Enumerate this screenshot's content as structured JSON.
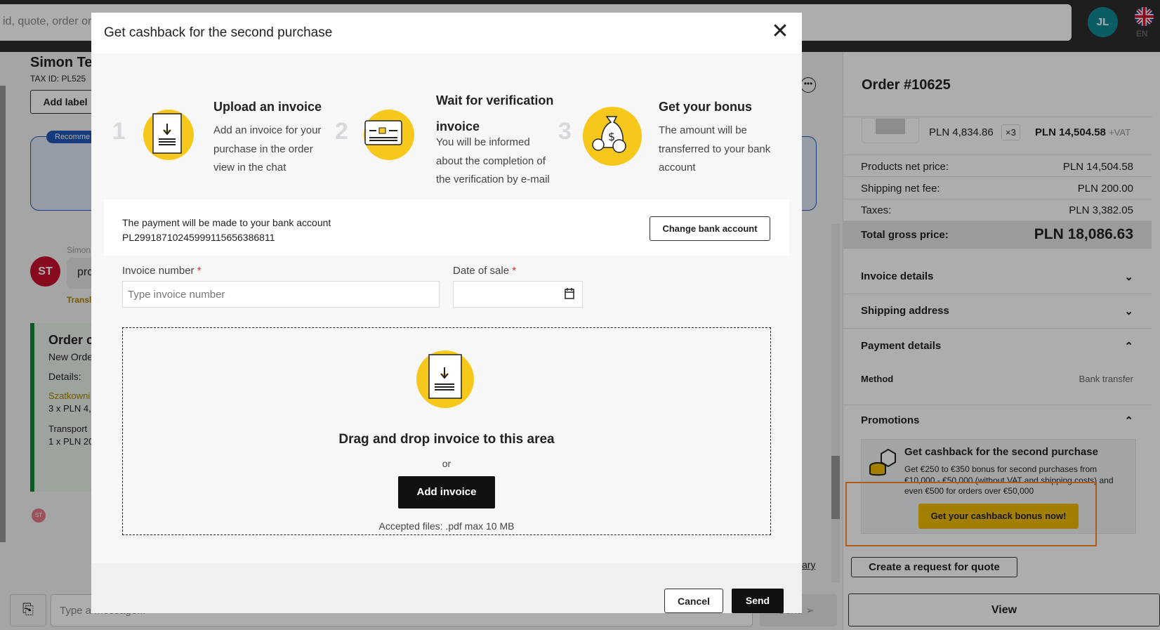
{
  "topbar": {
    "search_placeholder": "id, quote, order or",
    "avatar_initials": "JL",
    "language": "EN"
  },
  "left": {
    "customer_name": "Simon Te",
    "tax_id": "TAX ID: PL525",
    "add_label": "Add label",
    "recommended_badge": "Recomme",
    "sender": "Simon",
    "avatar_initials": "ST",
    "message": "pro",
    "translate": "Transl",
    "order_card": {
      "title": "Order c",
      "subtitle": "New Orde",
      "details_label": "Details:",
      "product_link": "Szatkowni",
      "product_qty": "3 x PLN 4,8",
      "transport": "Transport",
      "transport_qty": "1 x PLN 20"
    },
    "small_avatar": "ST",
    "summary_link": "ary",
    "message_placeholder": "Type a message...",
    "send_label": "Send"
  },
  "order": {
    "title": "Order #10625",
    "unit_price": "PLN 4,834.86",
    "qty": "×3",
    "line_total": "PLN 14,504.58",
    "vat_suffix": "+VAT",
    "rows": [
      {
        "label": "Products net price:",
        "value": "PLN 14,504.58"
      },
      {
        "label": "Shipping net fee:",
        "value": "PLN 200.00"
      },
      {
        "label": "Taxes:",
        "value": "PLN 3,382.05"
      }
    ],
    "total_label": "Total gross price:",
    "total_value": "PLN 18,086.63",
    "sections": [
      "Invoice details",
      "Shipping address",
      "Payment details"
    ],
    "method_label": "Method",
    "method_value": "Bank transfer",
    "promotions_label": "Promotions",
    "promo": {
      "title": "Get cashback for the second purchase",
      "text": "Get €250 to €350 bonus for second purchases from €10,000 - €50,000 (without VAT and shipping costs) and even €500 for orders over €50,000",
      "button": "Get your cashback bonus now!"
    },
    "quote_button": "Create a request for quote",
    "view_button": "View"
  },
  "modal": {
    "title": "Get cashback for the second purchase",
    "steps": [
      {
        "num": "1",
        "title": "Upload an invoice",
        "text": "Add an invoice for your purchase in the order view in the chat"
      },
      {
        "num": "2",
        "title": "Wait for verification invoice",
        "text": "You will be informed about the completion of the verification by e-mail"
      },
      {
        "num": "3",
        "title": "Get your bonus",
        "text": "The amount will be transferred to your bank account"
      }
    ],
    "bank_text": "The payment will be made to your bank account",
    "bank_account": "PL29918710245999115656386811",
    "change_bank": "Change bank account",
    "invoice_label": "Invoice number",
    "invoice_placeholder": "Type invoice number",
    "date_label": "Date of sale",
    "required_mark": "*",
    "drop_title": "Drag and drop invoice to this area",
    "or": "or",
    "add_invoice": "Add invoice",
    "accepted": "Accepted files: .pdf max 10 MB",
    "cancel": "Cancel",
    "send": "Send"
  },
  "colors": {
    "accent_yellow": "#f7c81c",
    "promo_button": "#f0bc00",
    "highlight_box": "#ff8a2a",
    "avatar_teal": "#0f8a95",
    "avatar_red": "#c8102e"
  }
}
